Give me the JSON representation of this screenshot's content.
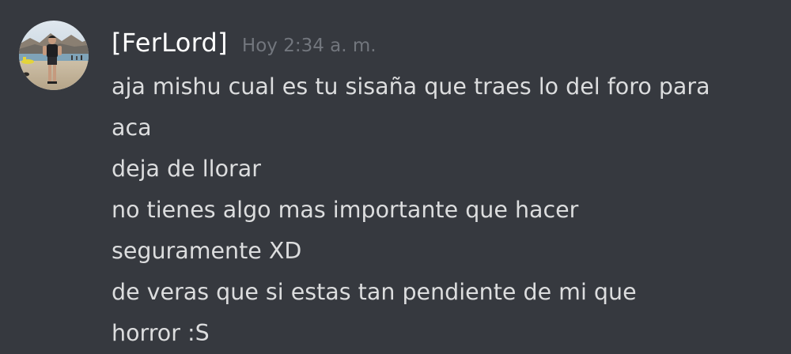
{
  "message": {
    "author": "[FerLord]",
    "timestamp": "Hoy 2:34 a. m.",
    "avatar_icon": "user-avatar-beach-photo",
    "lines": [
      "aja mishu cual es tu sisaña que traes lo del foro para",
      "aca",
      "deja de llorar",
      "no tienes algo mas importante que hacer",
      "seguramente XD",
      "de veras que si estas tan pendiente de mi que",
      "horror :S"
    ]
  },
  "colors": {
    "background": "#36393f",
    "username": "#ffffff",
    "timestamp": "#72767d",
    "text": "#dcddde"
  }
}
